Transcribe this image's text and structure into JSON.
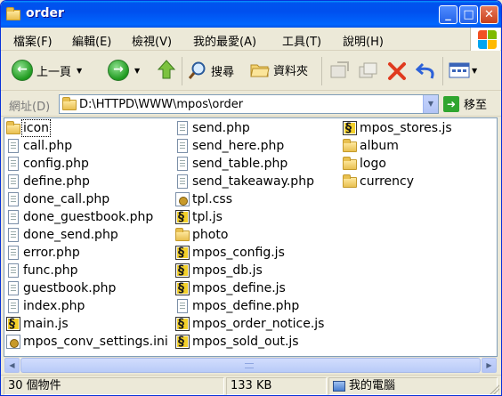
{
  "window": {
    "title": "order",
    "minimize": "_",
    "maximize": "□",
    "close": "✕"
  },
  "menu": [
    "檔案(F)",
    "編輯(E)",
    "檢視(V)",
    "我的最愛(A)",
    "工具(T)",
    "說明(H)"
  ],
  "toolbar": {
    "back_label": "上一頁",
    "search_label": "搜尋",
    "folders_label": "資料夾"
  },
  "address": {
    "label": "網址(D)",
    "value": "D:\\HTTPD\\WWW\\mpos\\order",
    "go_label": "移至"
  },
  "files": {
    "col1": [
      {
        "name": "icon",
        "type": "folder"
      },
      {
        "name": "call.php",
        "type": "doc"
      },
      {
        "name": "config.php",
        "type": "doc"
      },
      {
        "name": "define.php",
        "type": "doc"
      },
      {
        "name": "done_call.php",
        "type": "doc"
      },
      {
        "name": "done_guestbook.php",
        "type": "doc"
      },
      {
        "name": "done_send.php",
        "type": "doc"
      },
      {
        "name": "error.php",
        "type": "doc"
      },
      {
        "name": "func.php",
        "type": "doc"
      },
      {
        "name": "guestbook.php",
        "type": "doc"
      },
      {
        "name": "index.php",
        "type": "doc"
      },
      {
        "name": "main.js",
        "type": "js"
      },
      {
        "name": "mpos_conv_settings.ini",
        "type": "ini"
      }
    ],
    "col2": [
      {
        "name": "send.php",
        "type": "doc"
      },
      {
        "name": "send_here.php",
        "type": "doc"
      },
      {
        "name": "send_table.php",
        "type": "doc"
      },
      {
        "name": "send_takeaway.php",
        "type": "doc"
      },
      {
        "name": "tpl.css",
        "type": "ini"
      },
      {
        "name": "tpl.js",
        "type": "js"
      },
      {
        "name": "photo",
        "type": "folder"
      },
      {
        "name": "mpos_config.js",
        "type": "js"
      },
      {
        "name": "mpos_db.js",
        "type": "js"
      },
      {
        "name": "mpos_define.js",
        "type": "js"
      },
      {
        "name": "mpos_define.php",
        "type": "doc"
      },
      {
        "name": "mpos_order_notice.js",
        "type": "js"
      },
      {
        "name": "mpos_sold_out.js",
        "type": "js"
      }
    ],
    "col3": [
      {
        "name": "mpos_stores.js",
        "type": "js"
      },
      {
        "name": "album",
        "type": "folder"
      },
      {
        "name": "logo",
        "type": "folder"
      },
      {
        "name": "currency",
        "type": "folder"
      }
    ]
  },
  "status": {
    "count": "30 個物件",
    "size": "133 KB",
    "location": "我的電腦"
  },
  "colors": {
    "titlebar": "#0055e8",
    "chrome": "#ece9d8",
    "selection_outline": "#000000"
  }
}
